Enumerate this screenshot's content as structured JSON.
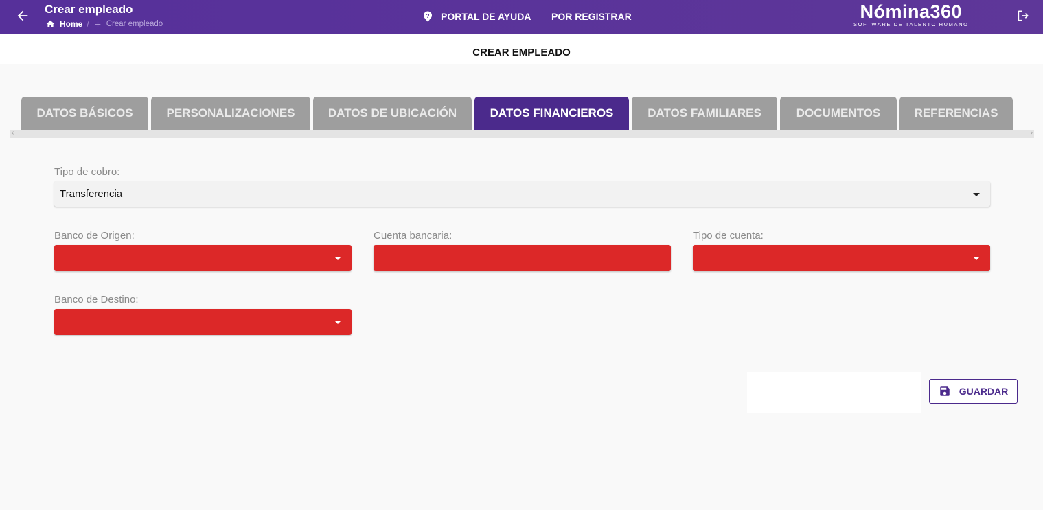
{
  "header": {
    "title": "Crear empleado",
    "breadcrumb": {
      "home": "Home",
      "separator": "/",
      "current": "Crear empleado"
    },
    "help_link": "PORTAL DE AYUDA",
    "register_link": "POR REGISTRAR",
    "brand": {
      "name": "Nómina360",
      "tagline": "SOFTWARE DE TALENTO HUMANO"
    },
    "colors": {
      "bar": "#56309a",
      "accent": "#4b2a8c"
    }
  },
  "subheader": {
    "title": "CREAR EMPLEADO"
  },
  "tabs": [
    {
      "label": "DATOS BÁSICOS",
      "active": false
    },
    {
      "label": "PERSONALIZACIONES",
      "active": false
    },
    {
      "label": "DATOS DE UBICACIÓN",
      "active": false
    },
    {
      "label": "DATOS FINANCIEROS",
      "active": true
    },
    {
      "label": "DATOS FAMILIARES",
      "active": false
    },
    {
      "label": "DOCUMENTOS",
      "active": false
    },
    {
      "label": "REFERENCIAS",
      "active": false
    }
  ],
  "form": {
    "tipo_cobro": {
      "label": "Tipo de cobro:",
      "value": "Transferencia"
    },
    "banco_origen": {
      "label": "Banco de Origen:",
      "value": ""
    },
    "cuenta_bancaria": {
      "label": "Cuenta bancaria:",
      "value": ""
    },
    "tipo_cuenta": {
      "label": "Tipo de cuenta:",
      "value": ""
    },
    "banco_destino": {
      "label": "Banco de Destino:",
      "value": ""
    },
    "error_color": "#dc2828"
  },
  "actions": {
    "save_label": "GUARDAR"
  }
}
